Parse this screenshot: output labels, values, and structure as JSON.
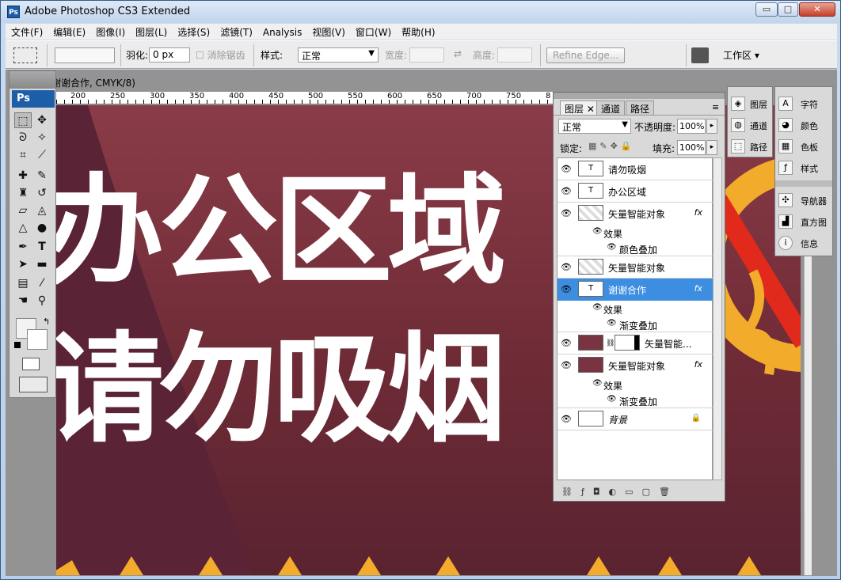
{
  "window": {
    "title": "Adobe Photoshop CS3 Extended",
    "app_icon": "Ps",
    "minimize": "▭",
    "maximize": "□",
    "close": "✕"
  },
  "menu": [
    "文件(F)",
    "编辑(E)",
    "图像(I)",
    "图层(L)",
    "选择(S)",
    "滤镜(T)",
    "Analysis",
    "视图(V)",
    "窗口(W)",
    "帮助(H)"
  ],
  "options": {
    "feather_label": "羽化:",
    "feather_value": "0 px",
    "antialias_label": "消除锯齿",
    "style_label": "样式:",
    "style_value": "正常",
    "width_label": "宽度:",
    "height_label": "高度:",
    "refine_edge": "Refine Edge...",
    "workspace": "工作区 ▾"
  },
  "document": {
    "tab_title": "谢谢合作, CMYK/8)",
    "ruler_ticks": [
      "200",
      "250",
      "300",
      "350",
      "400",
      "450",
      "500",
      "550",
      "600",
      "650",
      "700",
      "750",
      "8"
    ],
    "line1": "办公区域",
    "line2": "请勿吸烟"
  },
  "tools": {
    "ps_logo": "Ps",
    "text_tool": "T"
  },
  "layers_panel": {
    "tabs": [
      "图层",
      "通道",
      "路径"
    ],
    "blend_mode": "正常",
    "opacity_label": "不透明度:",
    "opacity_value": "100%",
    "lock_label": "锁定:",
    "fill_label": "填充:",
    "fill_value": "100%",
    "layers": [
      {
        "name": "请勿吸烟",
        "thumb": "T"
      },
      {
        "name": "办公区域",
        "thumb": "T"
      },
      {
        "name": "矢量智能对象",
        "fx": "fx"
      },
      {
        "name": "效果"
      },
      {
        "name": "颜色叠加"
      },
      {
        "name": "矢量智能对象"
      },
      {
        "name": "谢谢合作",
        "thumb": "T",
        "fx": "fx"
      },
      {
        "name": "效果"
      },
      {
        "name": "渐变叠加"
      },
      {
        "name": "矢量智能..."
      },
      {
        "name": "矢量智能对象",
        "fx": "fx"
      },
      {
        "name": "效果"
      },
      {
        "name": "渐变叠加"
      },
      {
        "name": "背景"
      }
    ],
    "footer_icons": [
      "link-icon",
      "fx-icon",
      "mask-icon",
      "adjustment-icon",
      "folder-icon",
      "new-layer-icon",
      "trash-icon"
    ]
  },
  "dock1": [
    "图层",
    "通道",
    "路径"
  ],
  "dock2": [
    "字符",
    "颜色",
    "色板",
    "样式",
    "导航器",
    "直方图",
    "信息"
  ],
  "colors": {
    "accent": "#3d8ee0",
    "canvas": "#7a3340",
    "logo_yellow": "#f3ab2b",
    "no_red": "#e12a1c"
  }
}
